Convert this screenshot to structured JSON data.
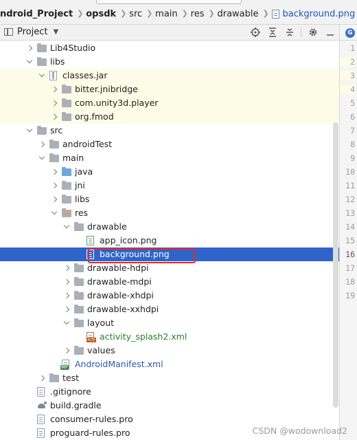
{
  "breadcrumb": [
    {
      "label": "ndroid_Project",
      "bold": true
    },
    {
      "label": "opsdk",
      "bold": true
    },
    {
      "label": "src"
    },
    {
      "label": "main"
    },
    {
      "label": "res"
    },
    {
      "label": "drawable"
    },
    {
      "label": "background.png",
      "file": true
    }
  ],
  "toolbar": {
    "title": "Project",
    "icons": [
      "locate-icon",
      "expand-all-icon",
      "collapse-all-icon",
      "settings-icon",
      "hide-icon"
    ]
  },
  "tree": [
    {
      "label": "Lib4Studio",
      "arrow": "right",
      "icon": "folder",
      "level": 2
    },
    {
      "label": "libs",
      "arrow": "down",
      "icon": "folder",
      "level": 2
    },
    {
      "label": "classes.jar",
      "arrow": "down",
      "icon": "jar",
      "level": 3,
      "yellow": true
    },
    {
      "label": "bitter.jnibridge",
      "arrow": "right",
      "icon": "folder",
      "level": 4,
      "yellow": true
    },
    {
      "label": "com.unity3d.player",
      "arrow": "right",
      "icon": "folder",
      "level": 4,
      "yellow": true
    },
    {
      "label": "org.fmod",
      "arrow": "right",
      "icon": "folder",
      "level": 4,
      "yellow": true
    },
    {
      "label": "src",
      "arrow": "down",
      "icon": "folder",
      "level": 2
    },
    {
      "label": "androidTest",
      "arrow": "right",
      "icon": "folder",
      "level": 3
    },
    {
      "label": "main",
      "arrow": "down",
      "icon": "folder",
      "level": 3
    },
    {
      "label": "java",
      "arrow": "right",
      "icon": "folder-src",
      "level": 4
    },
    {
      "label": "jni",
      "arrow": "right",
      "icon": "folder",
      "level": 4
    },
    {
      "label": "libs",
      "arrow": "right",
      "icon": "folder",
      "level": 4
    },
    {
      "label": "res",
      "arrow": "down",
      "icon": "folder-res",
      "level": 4
    },
    {
      "label": "drawable",
      "arrow": "down",
      "icon": "folder",
      "level": 5
    },
    {
      "label": "app_icon.png",
      "arrow": "",
      "icon": "png",
      "level": 6
    },
    {
      "label": "background.png",
      "arrow": "",
      "icon": "png",
      "level": 6,
      "selected": true
    },
    {
      "label": "drawable-hdpi",
      "arrow": "right",
      "icon": "folder",
      "level": 5
    },
    {
      "label": "drawable-mdpi",
      "arrow": "right",
      "icon": "folder",
      "level": 5
    },
    {
      "label": "drawable-xhdpi",
      "arrow": "right",
      "icon": "folder",
      "level": 5
    },
    {
      "label": "drawable-xxhdpi",
      "arrow": "right",
      "icon": "folder",
      "level": 5
    },
    {
      "label": "layout",
      "arrow": "down",
      "icon": "folder",
      "level": 5
    },
    {
      "label": "activity_splash2.xml",
      "arrow": "",
      "icon": "xml",
      "level": 6,
      "color": "green"
    },
    {
      "label": "values",
      "arrow": "right",
      "icon": "folder",
      "level": 5
    },
    {
      "label": "AndroidManifest.xml",
      "arrow": "",
      "icon": "manifest",
      "level": 4,
      "color": "blue"
    },
    {
      "label": "test",
      "arrow": "right",
      "icon": "folder",
      "level": 3
    },
    {
      "label": ".gitignore",
      "arrow": "",
      "icon": "doc",
      "level": 2
    },
    {
      "label": "build.gradle",
      "arrow": "",
      "icon": "gradle",
      "level": 2
    },
    {
      "label": "consumer-rules.pro",
      "arrow": "",
      "icon": "doc",
      "level": 2
    },
    {
      "label": "proguard-rules.pro",
      "arrow": "",
      "icon": "doc",
      "level": 2
    }
  ],
  "gutter": {
    "badge": "G",
    "line_numbers": [
      "1",
      "2",
      "3",
      "4",
      "5",
      "6",
      "7",
      "8",
      "9",
      "10",
      "11",
      "12",
      "13",
      "14",
      "15",
      "16",
      "17",
      "18",
      "19"
    ],
    "yellow_lines": [
      "2",
      "3",
      "4"
    ],
    "current_line": "16"
  },
  "watermark": "CSDN @wodownload2"
}
